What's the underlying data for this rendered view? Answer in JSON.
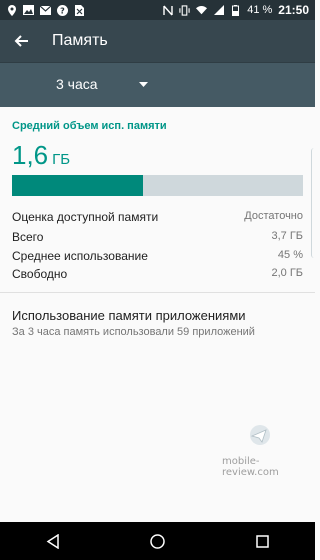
{
  "status_bar": {
    "time": "21:50",
    "battery_percent": "41 %",
    "icons_left": [
      "location-icon",
      "image-icon",
      "email-icon",
      "help-icon",
      "sim-icon"
    ],
    "icons_right": [
      "nfc-icon",
      "vibrate-icon",
      "wifi-icon",
      "signal-icon",
      "battery-icon"
    ]
  },
  "toolbar": {
    "title": "Память"
  },
  "spinner": {
    "selected": "3 часа"
  },
  "memory": {
    "section_title": "Средний объем исп. памяти",
    "value": "1,6",
    "unit": "ГБ",
    "used_fraction": 0.45,
    "rows": [
      {
        "label": "Оценка доступной памяти",
        "value": "Достаточно"
      },
      {
        "label": "Всего",
        "value": "3,7 ГБ"
      },
      {
        "label": "Среднее использование",
        "value": "45 %"
      },
      {
        "label": "Свободно",
        "value": "2,0 ГБ"
      }
    ]
  },
  "apps": {
    "title": "Использование памяти приложениями",
    "subtitle": "За 3 часа память использовали 59 приложений"
  },
  "watermark": {
    "text": "mobile-review.com"
  },
  "colors": {
    "accent": "#009688",
    "bar_fill": "#00897b",
    "bar_track": "#cfd8dc",
    "toolbar": "#37474f"
  }
}
